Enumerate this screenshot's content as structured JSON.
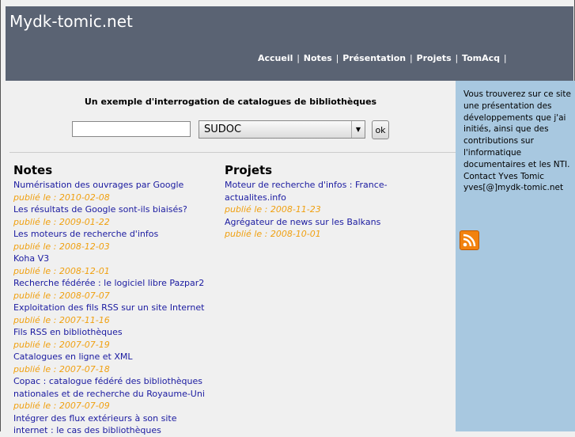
{
  "header": {
    "site_title": "Mydk-tomic.net"
  },
  "nav": {
    "items": [
      "Accueil",
      "Notes",
      "Présentation",
      "Projets",
      "TomAcq"
    ],
    "separator": "|"
  },
  "search": {
    "title": "Un exemple d'interrogation de catalogues de bibliothèques",
    "input_value": "",
    "selected_catalog": "SUDOC",
    "ok_label": "ok"
  },
  "notes": {
    "heading": "Notes",
    "items": [
      {
        "title": "Numérisation des ouvrages par Google",
        "date": "publié le : 2010-02-08"
      },
      {
        "title": "Les résultats de Google sont-ils biaisés?",
        "date": "publié le : 2009-01-22"
      },
      {
        "title": "Les moteurs de recherche d'infos",
        "date": "publié le : 2008-12-03"
      },
      {
        "title": "Koha V3",
        "date": "publié le : 2008-12-01"
      },
      {
        "title": "Recherche fédérée : le logiciel libre Pazpar2",
        "date": "publié le : 2008-07-07"
      },
      {
        "title": "Exploitation des fils RSS sur un site Internet",
        "date": "publié le : 2007-11-16"
      },
      {
        "title": "Fils RSS en bibliothèques",
        "date": "publié le : 2007-07-19"
      },
      {
        "title": "Catalogues en ligne et XML",
        "date": "publié le : 2007-07-18"
      },
      {
        "title": "Copac : catalogue fédéré des bibliothèques nationales et de recherche du Royaume-Uni",
        "date": "publié le : 2007-07-09"
      },
      {
        "title": "Intégrer des flux extérieurs à son site internet : le cas des bibliothèques",
        "date": ""
      }
    ]
  },
  "projets": {
    "heading": "Projets",
    "items": [
      {
        "title": "Moteur de recherche d'infos : France-actualites.info",
        "date": "publié le : 2008-11-23"
      },
      {
        "title": "Agrégateur de news sur les Balkans",
        "date": "publié le : 2008-10-01"
      }
    ]
  },
  "sidebar": {
    "text": "Vous trouverez sur ce site une présentation des développements que j'ai initiés, ainsi que des contributions sur l'informatique documentaires et les NTI.",
    "contact": "Contact Yves Tomic",
    "email": "yves[@]mydk-tomic.net",
    "rss_icon": "rss-icon"
  },
  "colors": {
    "header_bg": "#5a6373",
    "sidebar_bg": "#a8c8e0",
    "link": "#1a1aa0",
    "date": "#f0a010",
    "rss": "#f2820f"
  }
}
